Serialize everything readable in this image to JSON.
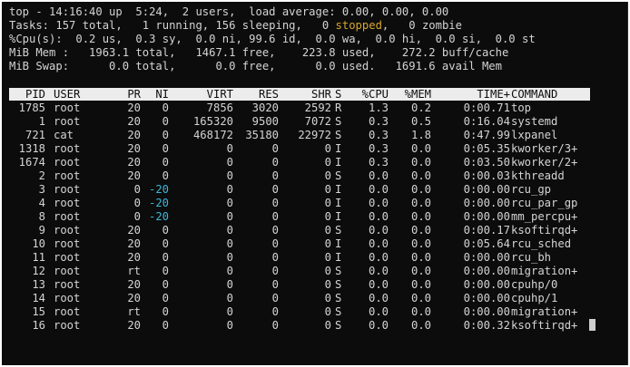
{
  "summary": {
    "line1": "top - 14:16:40 up  5:24,  2 users,  load average: 0.00, 0.00, 0.00",
    "tasks_a": "Tasks: 157 total,   1 running, 156 sleeping,   0 ",
    "tasks_stopped": "stopped",
    "tasks_b": ",   0 zombie",
    "cpu": "%Cpu(s):  0.2 us,  0.3 sy,  0.0 ni, 99.6 id,  0.0 wa,  0.0 hi,  0.0 si,  0.0 st",
    "mem": "MiB Mem :   1963.1 total,   1467.1 free,    223.8 used,    272.2 buff/cache",
    "swap": "MiB Swap:      0.0 total,      0.0 free,      0.0 used.   1691.6 avail Mem"
  },
  "header": {
    "pid": "PID",
    "user": "USER",
    "pr": "PR",
    "ni": "NI",
    "virt": "VIRT",
    "res": "RES",
    "shr": "SHR",
    "s": "S",
    "cpu": "%CPU",
    "mem": "%MEM",
    "time": "TIME+",
    "command": "COMMAND"
  },
  "processes": [
    {
      "pid": "1785",
      "user": "root",
      "pr": "20",
      "ni": "0",
      "virt": "7856",
      "res": "3020",
      "shr": "2592",
      "s": "R",
      "cpu": "1.3",
      "mem": "0.2",
      "time": "0:00.71",
      "command": "top"
    },
    {
      "pid": "1",
      "user": "root",
      "pr": "20",
      "ni": "0",
      "virt": "165320",
      "res": "9500",
      "shr": "7072",
      "s": "S",
      "cpu": "0.3",
      "mem": "0.5",
      "time": "0:16.04",
      "command": "systemd"
    },
    {
      "pid": "721",
      "user": "cat",
      "pr": "20",
      "ni": "0",
      "virt": "468172",
      "res": "35180",
      "shr": "22972",
      "s": "S",
      "cpu": "0.3",
      "mem": "1.8",
      "time": "0:47.99",
      "command": "lxpanel"
    },
    {
      "pid": "1318",
      "user": "root",
      "pr": "20",
      "ni": "0",
      "virt": "0",
      "res": "0",
      "shr": "0",
      "s": "I",
      "cpu": "0.3",
      "mem": "0.0",
      "time": "0:05.35",
      "command": "kworker/3+"
    },
    {
      "pid": "1674",
      "user": "root",
      "pr": "20",
      "ni": "0",
      "virt": "0",
      "res": "0",
      "shr": "0",
      "s": "I",
      "cpu": "0.3",
      "mem": "0.0",
      "time": "0:03.50",
      "command": "kworker/2+"
    },
    {
      "pid": "2",
      "user": "root",
      "pr": "20",
      "ni": "0",
      "virt": "0",
      "res": "0",
      "shr": "0",
      "s": "S",
      "cpu": "0.0",
      "mem": "0.0",
      "time": "0:00.03",
      "command": "kthreadd"
    },
    {
      "pid": "3",
      "user": "root",
      "pr": "0",
      "ni": "-20",
      "virt": "0",
      "res": "0",
      "shr": "0",
      "s": "I",
      "cpu": "0.0",
      "mem": "0.0",
      "time": "0:00.00",
      "command": "rcu_gp"
    },
    {
      "pid": "4",
      "user": "root",
      "pr": "0",
      "ni": "-20",
      "virt": "0",
      "res": "0",
      "shr": "0",
      "s": "I",
      "cpu": "0.0",
      "mem": "0.0",
      "time": "0:00.00",
      "command": "rcu_par_gp"
    },
    {
      "pid": "8",
      "user": "root",
      "pr": "0",
      "ni": "-20",
      "virt": "0",
      "res": "0",
      "shr": "0",
      "s": "I",
      "cpu": "0.0",
      "mem": "0.0",
      "time": "0:00.00",
      "command": "mm_percpu+"
    },
    {
      "pid": "9",
      "user": "root",
      "pr": "20",
      "ni": "0",
      "virt": "0",
      "res": "0",
      "shr": "0",
      "s": "S",
      "cpu": "0.0",
      "mem": "0.0",
      "time": "0:00.17",
      "command": "ksoftirqd+"
    },
    {
      "pid": "10",
      "user": "root",
      "pr": "20",
      "ni": "0",
      "virt": "0",
      "res": "0",
      "shr": "0",
      "s": "I",
      "cpu": "0.0",
      "mem": "0.0",
      "time": "0:05.64",
      "command": "rcu_sched"
    },
    {
      "pid": "11",
      "user": "root",
      "pr": "20",
      "ni": "0",
      "virt": "0",
      "res": "0",
      "shr": "0",
      "s": "I",
      "cpu": "0.0",
      "mem": "0.0",
      "time": "0:00.00",
      "command": "rcu_bh"
    },
    {
      "pid": "12",
      "user": "root",
      "pr": "rt",
      "ni": "0",
      "virt": "0",
      "res": "0",
      "shr": "0",
      "s": "S",
      "cpu": "0.0",
      "mem": "0.0",
      "time": "0:00.00",
      "command": "migration+"
    },
    {
      "pid": "13",
      "user": "root",
      "pr": "20",
      "ni": "0",
      "virt": "0",
      "res": "0",
      "shr": "0",
      "s": "S",
      "cpu": "0.0",
      "mem": "0.0",
      "time": "0:00.00",
      "command": "cpuhp/0"
    },
    {
      "pid": "14",
      "user": "root",
      "pr": "20",
      "ni": "0",
      "virt": "0",
      "res": "0",
      "shr": "0",
      "s": "S",
      "cpu": "0.0",
      "mem": "0.0",
      "time": "0:00.00",
      "command": "cpuhp/1"
    },
    {
      "pid": "15",
      "user": "root",
      "pr": "rt",
      "ni": "0",
      "virt": "0",
      "res": "0",
      "shr": "0",
      "s": "S",
      "cpu": "0.0",
      "mem": "0.0",
      "time": "0:00.00",
      "command": "migration+"
    },
    {
      "pid": "16",
      "user": "root",
      "pr": "20",
      "ni": "0",
      "virt": "0",
      "res": "0",
      "shr": "0",
      "s": "S",
      "cpu": "0.0",
      "mem": "0.0",
      "time": "0:00.32",
      "command": "ksoftirqd+"
    }
  ],
  "colors": {
    "background": "#0c0c0c",
    "text": "#d4d4d4",
    "header_bg": "#ececec",
    "stopped": "#d7a72e",
    "negative_nice": "#3fb6d8"
  }
}
